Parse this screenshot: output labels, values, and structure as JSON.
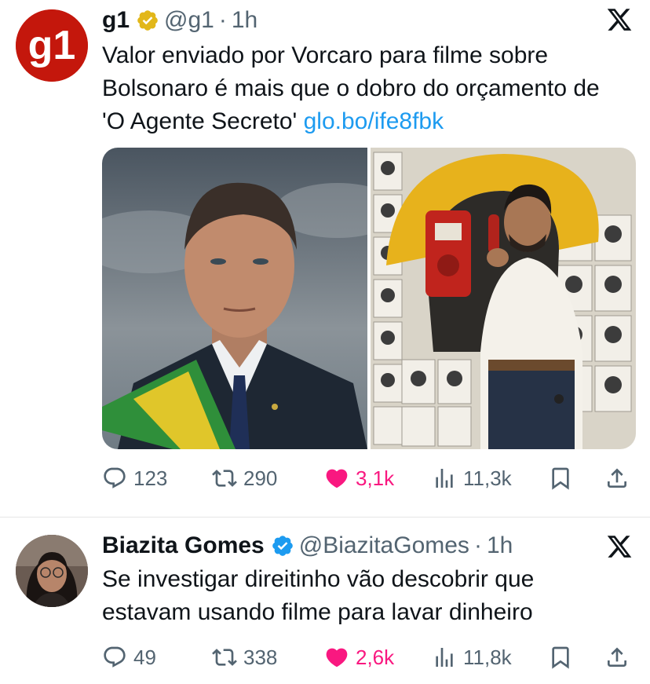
{
  "tweets": [
    {
      "author": {
        "name": "g1",
        "handle": "@g1",
        "logo_text": "g1",
        "verified_type": "gold",
        "avatar_icon": "g1-logo-icon"
      },
      "separator": "·",
      "time": "1h",
      "text_lines": [
        "Valor enviado por Vorcaro para filme sobre",
        "Bolsonaro é mais que o dobro do orçamento de"
      ],
      "text_last_line": "'O Agente Secreto' ",
      "link": "glo.bo/ife8fbk",
      "media": [
        {
          "description_icon": "photo-man-with-presidential-sash"
        },
        {
          "description_icon": "photo-man-in-phone-booth"
        }
      ],
      "stats": {
        "replies": "123",
        "retweets": "290",
        "likes": "3,1k",
        "views": "11,3k"
      }
    },
    {
      "author": {
        "name": "Biazita Gomes",
        "handle": "@BiazitaGomes",
        "verified_type": "blue",
        "avatar_icon": "profile-photo"
      },
      "separator": "·",
      "time": "1h",
      "text_lines": [
        "Se investigar direitinho vão descobrir que",
        "estavam usando filme para lavar dinheiro"
      ],
      "stats": {
        "replies": "49",
        "retweets": "338",
        "likes": "2,6k",
        "views": "11,8k"
      }
    }
  ],
  "colors": {
    "link": "#1d9bf0",
    "like": "#f91880",
    "muted": "#536471",
    "gold_badge": "#e2b719",
    "blue_badge": "#1d9bf0",
    "g1_red": "#c4170c"
  }
}
